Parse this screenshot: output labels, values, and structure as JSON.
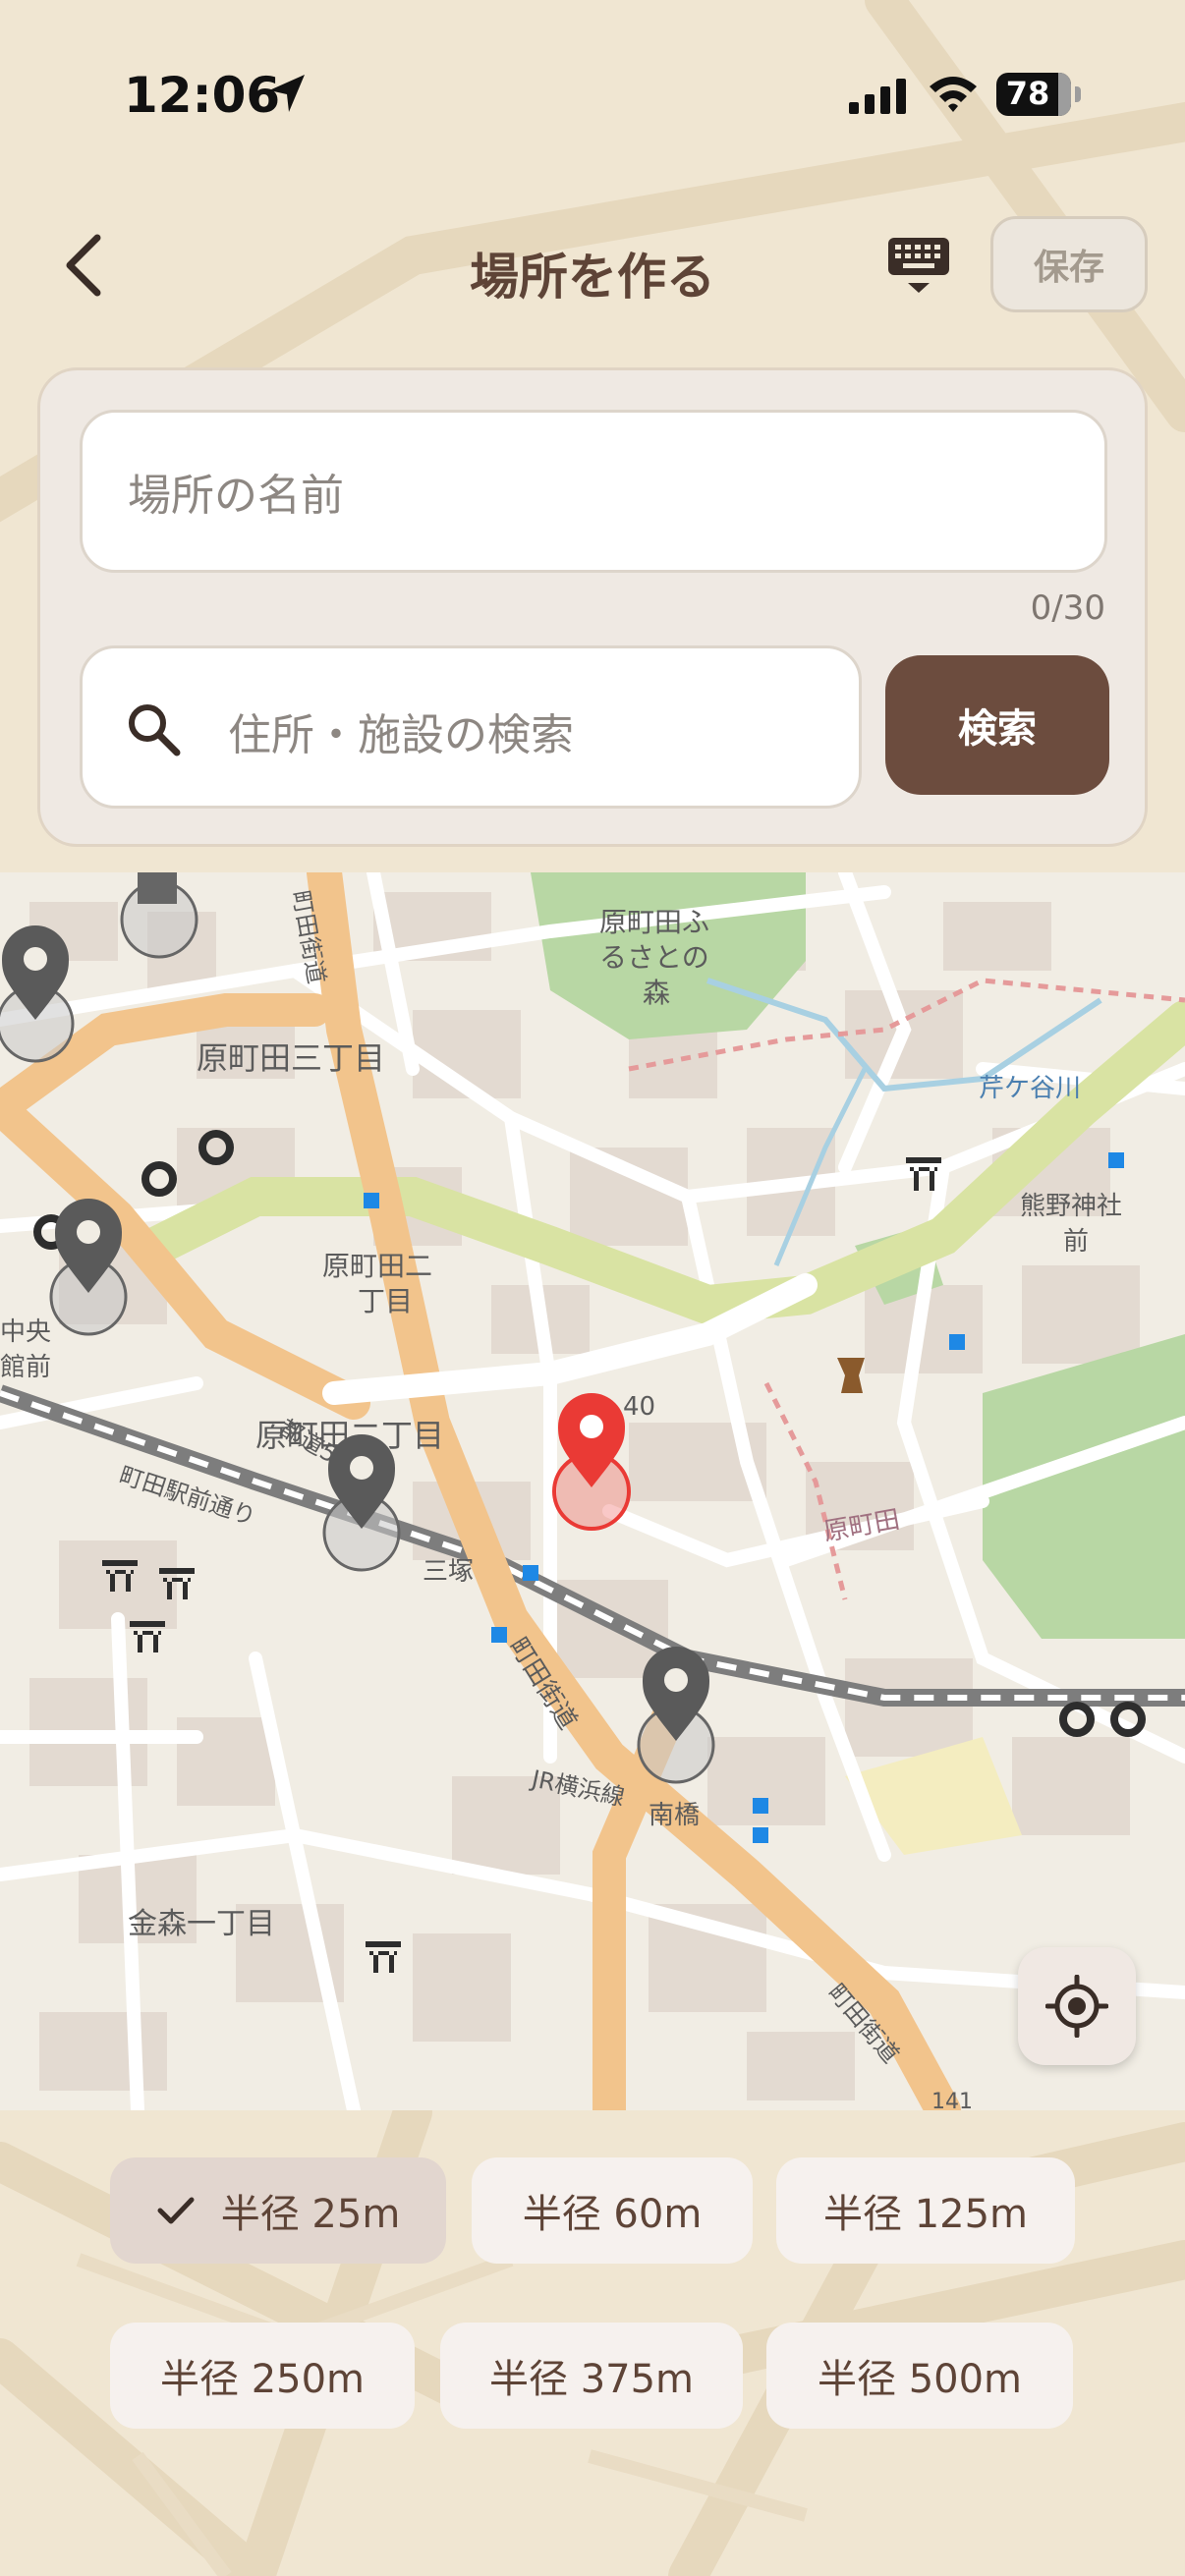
{
  "status": {
    "time": "12:06",
    "battery": "78"
  },
  "header": {
    "title": "場所を作る",
    "save_label": "保存"
  },
  "form": {
    "name_placeholder": "場所の名前",
    "name_counter": "0/30",
    "search_placeholder": "住所・施設の検索",
    "search_button": "検索"
  },
  "map": {
    "labels": {
      "l1": "原町田ふ",
      "l2": "るさとの",
      "l3": "森",
      "l4": "原町田三丁目",
      "l5": "原町田二",
      "l6": "丁目",
      "l7": "原町田二丁目",
      "l8": "町田駅前通り",
      "l9": "三塚",
      "l10": "町田街道",
      "l11": "JR横浜線",
      "l12": "南橋",
      "l13": "金森一丁目",
      "l14": "熊野神社",
      "l15": "前",
      "l16": "芹ケ谷川",
      "l17": "原町田",
      "l18": "町田街道",
      "l19": "40",
      "l20": "141",
      "l21": "中央",
      "l22": "館前",
      "l23": "町田街道",
      "l24": "都道56号"
    }
  },
  "radius_options": [
    {
      "label": "半径 25m",
      "selected": true
    },
    {
      "label": "半径 60m",
      "selected": false
    },
    {
      "label": "半径 125m",
      "selected": false
    },
    {
      "label": "半径 250m",
      "selected": false
    },
    {
      "label": "半径 375m",
      "selected": false
    },
    {
      "label": "半径 500m",
      "selected": false
    }
  ],
  "colors": {
    "accent": "#6c4c3e",
    "pin_selected": "#ea3a35",
    "pin_other": "#555555",
    "background": "#f0e6d2"
  }
}
